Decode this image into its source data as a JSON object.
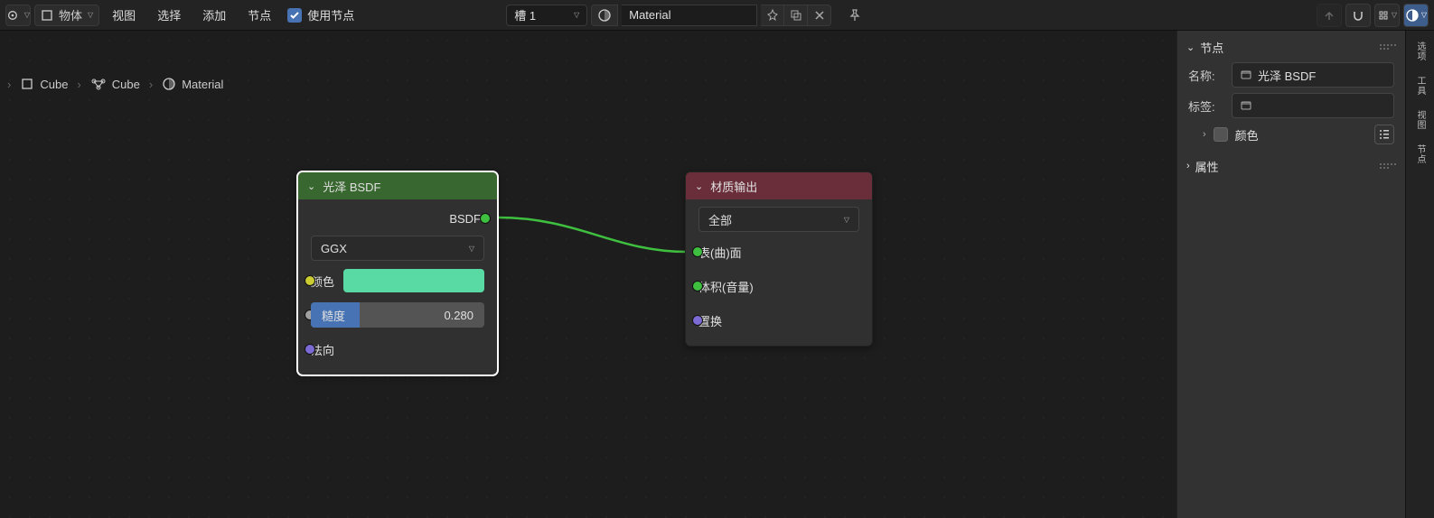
{
  "header": {
    "mode_label": "物体",
    "menus": [
      "视图",
      "选择",
      "添加",
      "节点"
    ],
    "use_nodes_label": "使用节点",
    "slot_label": "槽 1",
    "material_name": "Material"
  },
  "breadcrumb": {
    "obj1": "Cube",
    "obj2": "Cube",
    "mat": "Material"
  },
  "node_bsdf": {
    "title": "光泽 BSDF",
    "output_label": "BSDF",
    "distribution_value": "GGX",
    "color_label": "颜色",
    "color_value": "#59d9a4",
    "roughness_label": "糙度",
    "roughness_value": "0.280",
    "roughness_fill_pct": 28,
    "normal_label": "法向"
  },
  "node_output": {
    "title": "材质输出",
    "target_value": "全部",
    "surface_label": "表(曲)面",
    "volume_label": "体积(音量)",
    "displacement_label": "置换"
  },
  "sidebar": {
    "panel_node": "节点",
    "name_label": "名称:",
    "name_value": "光泽 BSDF",
    "tag_label": "标签:",
    "tag_value": "",
    "color_label": "颜色",
    "panel_attr": "属性"
  },
  "iconstrip": {
    "items": [
      "选项",
      "工具",
      "视图",
      "节点"
    ]
  }
}
